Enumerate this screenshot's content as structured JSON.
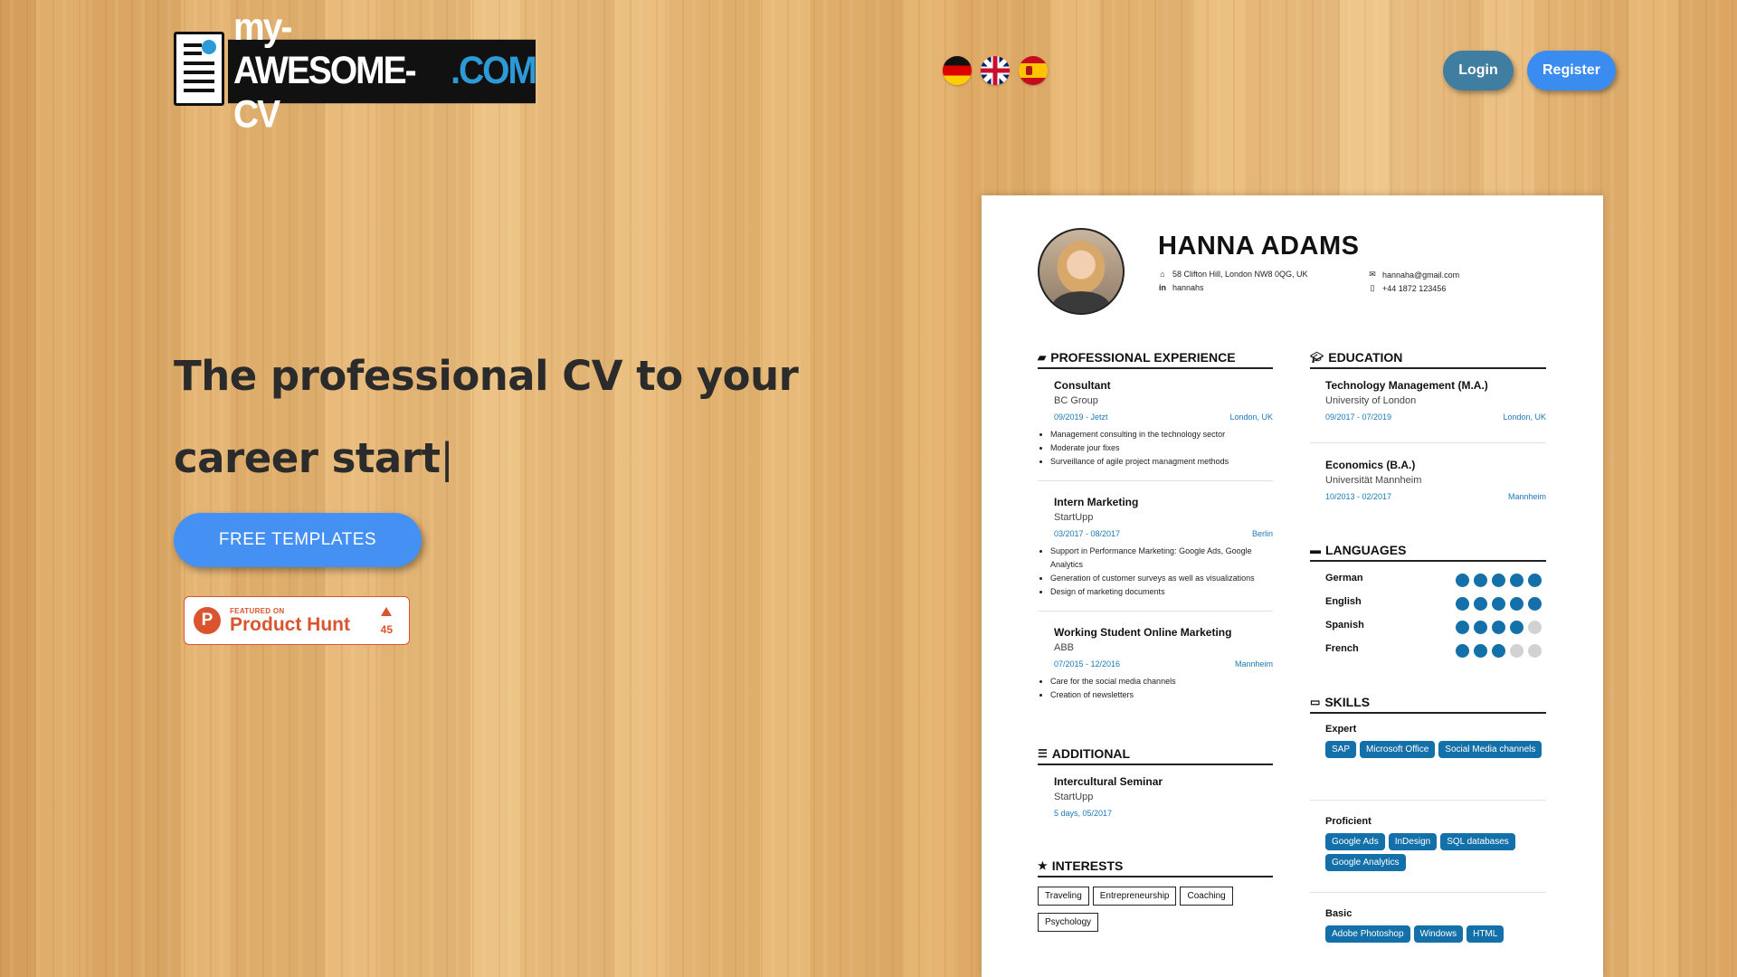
{
  "logo": {
    "text_main": "my-AWESOME-CV",
    "text_tld": ".COM"
  },
  "languages_nav": [
    {
      "code": "de",
      "icon": "germany-flag-icon"
    },
    {
      "code": "en",
      "icon": "uk-flag-icon"
    },
    {
      "code": "es",
      "icon": "spain-flag-icon"
    }
  ],
  "auth": {
    "login_label": "Login",
    "register_label": "Register"
  },
  "hero": {
    "title": "The professional CV to your career start",
    "cursor": "|",
    "cta_label": "FREE TEMPLATES"
  },
  "product_hunt": {
    "featured": "FEATURED ON",
    "name": "Product Hunt",
    "logo_letter": "P",
    "votes": "45"
  },
  "cv": {
    "name": "HANNA ADAMS",
    "address": "58 Clifton Hill, London NW8 0QG, UK",
    "linkedin": "hannahs",
    "email": "hannaha@gmail.com",
    "phone": "+44 1872 123456",
    "experience": {
      "heading": "PROFESSIONAL EXPERIENCE",
      "items": [
        {
          "title": "Consultant",
          "company": "BC Group",
          "date": "09/2019 - Jetzt",
          "location": "London, UK",
          "bullets": [
            "Management consulting in the technology sector",
            "Moderate jour fixes",
            "Surveillance of agile project managment methods"
          ]
        },
        {
          "title": "Intern Marketing",
          "company": "StartUpp",
          "date": "03/2017 - 08/2017",
          "location": "Berlin",
          "bullets": [
            "Support in Performance Marketing: Google Ads, Google Analytics",
            "Generation of customer surveys as well as visualizations",
            "Design of marketing documents"
          ]
        },
        {
          "title": "Working Student Online Marketing",
          "company": "ABB",
          "date": "07/2015 - 12/2016",
          "location": "Mannheim",
          "bullets": [
            "Care for the social media channels",
            "Creation of newsletters"
          ]
        }
      ]
    },
    "additional": {
      "heading": "ADDITIONAL",
      "items": [
        {
          "title": "Intercultural Seminar",
          "company": "StartUpp",
          "date": "5 days, 05/2017"
        }
      ]
    },
    "interests": {
      "heading": "INTERESTS",
      "items": [
        "Traveling",
        "Entrepreneurship",
        "Coaching",
        "Psychology"
      ]
    },
    "education": {
      "heading": "EDUCATION",
      "items": [
        {
          "title": "Technology Management (M.A.)",
          "school": "University of London",
          "date": "09/2017 - 07/2019",
          "location": "London, UK"
        },
        {
          "title": "Economics (B.A.)",
          "school": "Universität Mannheim",
          "date": "10/2013 - 02/2017",
          "location": "Mannheim"
        }
      ]
    },
    "languages": {
      "heading": "LANGUAGES",
      "items": [
        {
          "name": "German",
          "level": 5,
          "max": 5
        },
        {
          "name": "English",
          "level": 5,
          "max": 5
        },
        {
          "name": "Spanish",
          "level": 4,
          "max": 5
        },
        {
          "name": "French",
          "level": 3,
          "max": 5
        }
      ]
    },
    "skills": {
      "heading": "SKILLS",
      "groups": [
        {
          "level": "Expert",
          "tags": [
            "SAP",
            "Microsoft Office",
            "Social Media channels"
          ]
        },
        {
          "level": "Proficient",
          "tags": [
            "Google Ads",
            "InDesign",
            "SQL databases",
            "Google Analytics"
          ]
        },
        {
          "level": "Basic",
          "tags": [
            "Adobe Photoshop",
            "Windows",
            "HTML"
          ]
        }
      ]
    }
  },
  "colors": {
    "accent": "#1470a8",
    "primary_button": "#4590f3",
    "login_button": "#3f7ea1",
    "product_hunt": "#da552f"
  }
}
